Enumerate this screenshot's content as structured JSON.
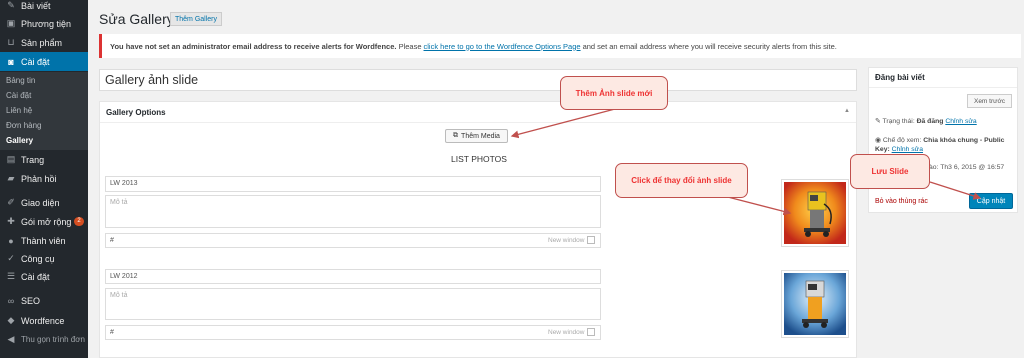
{
  "sidebar": {
    "items": [
      {
        "label": "Bài viết",
        "icon": "pin-icon"
      },
      {
        "label": "Phương tiện",
        "icon": "media-icon"
      },
      {
        "label": "Sản phẩm",
        "icon": "cart-icon"
      },
      {
        "label": "Cài đặt",
        "icon": "settings-icon"
      },
      {
        "label": "Trang",
        "icon": "page-icon"
      },
      {
        "label": "Phản hồi",
        "icon": "comment-icon"
      },
      {
        "label": "Giao diện",
        "icon": "brush-icon"
      },
      {
        "label": "Gói mở rộng",
        "icon": "plugin-icon"
      },
      {
        "label": "Thành viên",
        "icon": "user-icon"
      },
      {
        "label": "Công cụ",
        "icon": "wrench-icon"
      },
      {
        "label": "Cài đặt",
        "icon": "sliders-icon"
      },
      {
        "label": "SEO",
        "icon": "seo-icon"
      },
      {
        "label": "Wordfence",
        "icon": "shield-icon"
      },
      {
        "label": "Thu gọn trình đơn",
        "icon": "collapse-icon"
      }
    ],
    "plugin_badge": "2",
    "submenu": [
      "Bảng tin",
      "Cài đặt",
      "Liên hệ",
      "Đơn hàng",
      "Gallery"
    ]
  },
  "header": {
    "title": "Sửa Gallery",
    "add_button": "Thêm Gallery"
  },
  "notice": {
    "bold": "You have not set an administrator email address to receive alerts for Wordfence.",
    "pre": "Please",
    "link": "click here to go to the Wordfence Options Page",
    "post": "and set an email address where you will receive security alerts from this site."
  },
  "post_title": "Gallery ảnh slide",
  "gallery": {
    "box_title": "Gallery Options",
    "add_media": "Thêm Media",
    "list_title": "LIST PHOTOS",
    "photos": [
      {
        "title": "LW 2013",
        "desc_placeholder": "Mô tả",
        "link": "#",
        "new_window": "New window"
      },
      {
        "title": "LW 2012",
        "desc_placeholder": "Mô tả",
        "link": "#",
        "new_window": "New window"
      }
    ]
  },
  "publish": {
    "title": "Đăng bài viết",
    "preview": "Xem trước",
    "status_label": "Trạng thái:",
    "status_value": "Đã đăng",
    "edit": "Chỉnh sửa",
    "visibility_label": "Chế độ xem:",
    "visibility_value": "Chia khóa chung - Public",
    "key_label": "Key:",
    "date_partial": "ào: Th3 6, 2015 @ 16:57",
    "trash": "Bỏ vào thùng rác",
    "update": "Cập nhật"
  },
  "callouts": {
    "add_slide": "Thêm Ảnh slide mới",
    "change_image": "Click để thay đổi ảnh slide",
    "save_slide": "Lưu Slide"
  },
  "colors": {
    "accent": "#0073aa",
    "sidebar": "#23282d",
    "callout_text": "#ee3333",
    "callout_bg": "#fde9e3"
  }
}
